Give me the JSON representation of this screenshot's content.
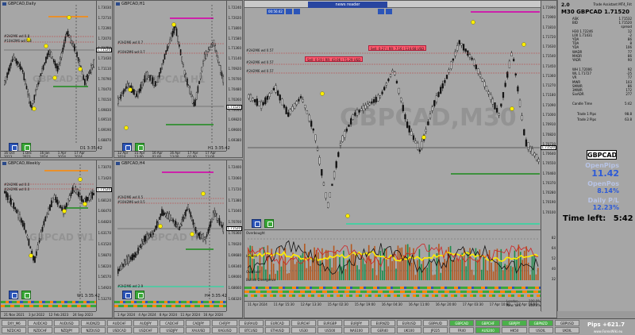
{
  "panes": {
    "daily": {
      "title": "GBPCAD,Daily",
      "watermark": "GBPCAD D1",
      "timer": "D1 3:35:42",
      "prices": [
        "1.73030",
        "1.72710",
        "1.72390",
        "1.72070",
        "1.71750",
        "1.71430",
        "1.71110",
        "1.70790",
        "1.70470",
        "1.70150",
        "1.69830",
        "1.69510",
        "1.69190",
        "1.68870"
      ],
      "current": "1.71520",
      "dates": [
        "16 Oct 2023",
        "1 Dec 2023",
        "16 Jan 2024",
        "1 Apr 2024",
        "17 Apr 2024"
      ],
      "levels": [
        "#2H2M6 wd 0.8",
        "#10H2M6 wd 0.8"
      ]
    },
    "h1": {
      "title": "GBPCAD,H1",
      "watermark": "GBPCAD H1",
      "timer": "H1 3:35:42",
      "prices": [
        "1.72240",
        "1.72020",
        "1.71800",
        "1.71580",
        "1.71360",
        "1.71140",
        "1.70920",
        "1.70700",
        "1.70480",
        "1.70260",
        "1.70040",
        "1.69820",
        "1.69600",
        "1.69380"
      ],
      "current": "1.71520",
      "dates": [
        "12 Apr 2024",
        "15 Apr 13:00",
        "16 Apr 01:00",
        "16 Apr 13:00",
        "17 Apr 01:00",
        "17 Apr 13:00"
      ],
      "levels": [
        "#2H2M6 wd 0.7",
        "#10H2M6 wd 0.7"
      ]
    },
    "weekly": {
      "title": "GBPCAD,Weekly",
      "watermark": "GBPCAD W1",
      "timer": "W1 3:35:42",
      "prices": [
        "1.73070",
        "1.71420",
        "1.69770",
        "1.68120",
        "1.66470",
        "1.64820",
        "1.63170",
        "1.61520",
        "1.59870",
        "1.58220",
        "1.56570",
        "1.54920",
        "1.53270"
      ],
      "current": "1.71520",
      "dates": [
        "21 Nov 2021",
        "3 Jul 2022",
        "12 Feb 2023",
        "24 Sep 2023"
      ],
      "levels": [
        "#2H2M6 wd 0.0",
        "#2H2M6 wd 0.0"
      ]
    },
    "h4": {
      "title": "GBPCAD,H4",
      "watermark": "GBPCAD H4",
      "timer": "H4 3:35:42",
      "prices": [
        "1.72400",
        "1.72060",
        "1.71720",
        "1.71380",
        "1.71040",
        "1.70700",
        "1.70360",
        "1.70020",
        "1.69680",
        "1.69340",
        "1.69000",
        "1.68660",
        "1.68320"
      ],
      "current": "1.71520",
      "dates": [
        "1 Apr 2024",
        "4 Apr 2024",
        "8 Apr 2024",
        "11 Apr 2024",
        "16 Apr 2024"
      ],
      "levels": [
        "#2H2M6 wd 0.5",
        "#10H2M6 wd 0.5",
        "#2H2M6 wd 2.9"
      ]
    }
  },
  "main": {
    "toolbar_time": "00:56:42",
    "news_label": "news reader",
    "watermark": "GBPCAD,M30",
    "sell_1": "Sell: 0.27 | RR: 7.16 | 114.68 USD",
    "sell_2": "Sell: 0.19 | RR: 43.06 | 71.29 USD",
    "levels": [
      "#2H2M6 wd 0.57",
      "#2H2M6 wd 0.57",
      "#2H2M6 wd 0.57"
    ],
    "prices": [
      "1.71990",
      "1.71900",
      "1.71810",
      "1.71720",
      "1.71630",
      "1.71540",
      "1.71450",
      "1.71360",
      "1.71270",
      "1.71180",
      "1.71090",
      "1.71000",
      "1.70910",
      "1.70820",
      "1.70730",
      "1.70640",
      "1.70550",
      "1.70460",
      "1.70370",
      "1.70280",
      "1.70190",
      "1.70100"
    ],
    "current": "1.71520",
    "dates": [
      "11 Apr 2024",
      "11 Apr 15:30",
      "12 Apr 13:30",
      "15 Apr 02:30",
      "15 Apr 19:00",
      "16 Apr 04:30",
      "16 Apr 11:00",
      "16 Apr 20:00",
      "17 Apr 03:30",
      "17 Apr 10:00",
      "17 Apr 19:00"
    ],
    "indicator_labels": [
      "Overbought",
      "Hidden",
      "Oversold",
      "Bullish Divergence"
    ],
    "indicator_scale": [
      "82",
      "64",
      "52",
      "40",
      "32"
    ],
    "session_labels": [
      "London",
      "New York"
    ],
    "session_values": [
      "100.0%",
      "100.0%"
    ]
  },
  "right_panel": {
    "version": "2.0",
    "app": "Trade Assistant MT4_Frit",
    "symbol_price": "M30 GBPCAD 1.71520",
    "rows": [
      [
        "ASK",
        "1.71532"
      ],
      [
        "BID",
        "1.71520"
      ],
      [
        "",
        "spread"
      ],
      [
        "H30 1.72246",
        "12"
      ],
      [
        "L00 1.71431",
        "-2"
      ],
      [
        "YDA",
        "86"
      ],
      [
        "TDA",
        "8"
      ],
      [
        "YDA",
        "106"
      ],
      [
        "WADR",
        "77"
      ],
      [
        "MADR",
        "86"
      ],
      [
        "YADR",
        "90"
      ]
    ],
    "rows2": [
      [
        "WH 1.72006",
        "92"
      ],
      [
        "WL 1.71727",
        "-25"
      ],
      [
        "VR",
        "77"
      ],
      [
        "MWR",
        "103"
      ],
      [
        "SMWR",
        "86"
      ],
      [
        "3MWR",
        "172"
      ],
      [
        "SixADR",
        "277"
      ]
    ],
    "candle_time_label": "Candle Time",
    "candle_time": "5:42",
    "trade1_label": "Trade 1 Pips",
    "trade1_val": "98.8",
    "trade2_label": "Trade 2 Pips",
    "trade2_val": "63.8",
    "symbol_badge": "GBPCAD",
    "open_pips_label": "OpenPips",
    "open_pips": "11.42",
    "open_pos_label": "OpenPos",
    "open_pos": "8.14%",
    "daily_pl_label": "Daily P/L",
    "daily_pl": "12.23%",
    "time_left_label": "Time left:",
    "time_left": "5:42"
  },
  "symbols": {
    "row1": [
      "DXY_M6",
      "AUDCAD",
      "AUDUSD",
      "AUDNZD",
      "AUDCHF",
      "AUDJPY",
      "CADCHF",
      "CADJPY",
      "CHFJPY",
      "EURAUD",
      "EURCAD",
      "EURCHF",
      "EURGBP",
      "EURJPY",
      "EURNZD",
      "EURUSD",
      "GBPAUD",
      "GBPCAD",
      "GBPCHF",
      "GBPJPY",
      "GBPNZD",
      "GBPUSD"
    ],
    "row1_on": [
      17,
      18,
      19,
      20
    ],
    "row2": [
      "NZDCAD",
      "NZDCHF",
      "NZDJPY",
      "NZDUSD",
      "USDCAD",
      "USDCHF",
      "USDJPY",
      "XAUUSD",
      "XAGUSD",
      "BTCUSD",
      "ETHUSD",
      "US30",
      "US500",
      "NAS100",
      "GER40",
      "UK100",
      "JP225",
      "FR40",
      "AUS200",
      "HK50",
      "USOIL",
      "UKOIL"
    ],
    "row2_on": [
      18
    ],
    "pips_total": "Pips +621.7",
    "footer": "www.ForexWiki.eu"
  },
  "colors": {
    "accent_blue": "#2c55b8",
    "accent_green": "#3aa838",
    "sell_red": "#ff5a6e",
    "level_magenta": "#cc22aa",
    "level_orange": "#ff8800"
  }
}
